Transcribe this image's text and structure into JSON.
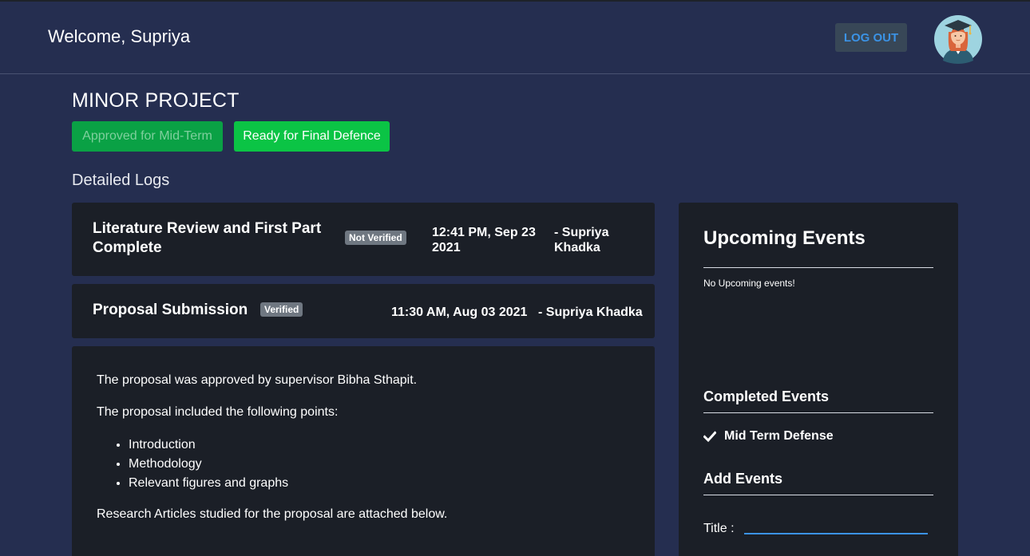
{
  "header": {
    "welcome": "Welcome, Supriya",
    "logout_label": "LOG OUT"
  },
  "project": {
    "title": "MINOR PROJECT",
    "btn_mid_term": "Approved for Mid-Term",
    "btn_final": "Ready for Final Defence"
  },
  "logs": {
    "heading": "Detailed Logs",
    "items": [
      {
        "title_line1": "Literature Review and First Part",
        "title_line2": "Complete",
        "status": "Not Verified",
        "time_line1": "12:41 PM, Sep 23",
        "time_line2": "2021",
        "author_line1": "- Supriya",
        "author_line2": "Khadka"
      },
      {
        "title": "Proposal Submission",
        "status": "Verified",
        "time": "11:30 AM, Aug 03 2021",
        "author": "- Supriya Khadka"
      }
    ],
    "body": {
      "para1": "The proposal was approved by supervisor Bibha Sthapit.",
      "para2": "The proposal included the following points:",
      "points": [
        "Introduction",
        "Methodology",
        "Relevant figures and graphs"
      ],
      "para3": "Research Articles studied for the proposal are attached below."
    }
  },
  "sidebar": {
    "upcoming_title": "Upcoming Events",
    "upcoming_empty": "No Upcoming events!",
    "completed_title": "Completed Events",
    "completed_items": [
      "Mid Term Defense"
    ],
    "add_title": "Add Events",
    "title_label": "Title :",
    "title_value": ""
  },
  "colors": {
    "page_bg": "#252e50",
    "card_bg": "#1b1f27",
    "accent_blue": "#3b93e6",
    "green": "#0bc445",
    "badge_grey": "#6f7781"
  },
  "icons": [
    "avatar-graduate-icon",
    "check-icon"
  ]
}
